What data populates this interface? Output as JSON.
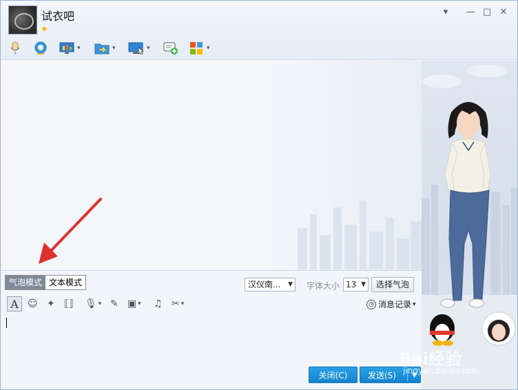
{
  "header": {
    "contact_name": "试衣吧",
    "window_controls": [
      "▾",
      "—",
      "□",
      "✕"
    ]
  },
  "toolbar": {
    "items": [
      {
        "name": "microphone-icon",
        "glyph": "🎙",
        "dropdown": false
      },
      {
        "name": "webcam-icon",
        "glyph": "◉",
        "dropdown": false
      },
      {
        "name": "screen-share-icon",
        "glyph": "▥",
        "dropdown": true
      },
      {
        "name": "file-transfer-icon",
        "glyph": "➜",
        "dropdown": true
      },
      {
        "name": "remote-desktop-icon",
        "glyph": "▭",
        "dropdown": true
      },
      {
        "name": "new-discussion-icon",
        "glyph": "✚",
        "dropdown": false
      },
      {
        "name": "apps-icon",
        "glyph": "▦",
        "dropdown": true
      }
    ]
  },
  "input": {
    "mode_bubble": "气泡模式",
    "mode_text": "文本模式",
    "font_name": "汉仪南...",
    "font_size_label": "字体大小",
    "font_size": "13",
    "choose_bubble": "选择气泡",
    "history": "消息记录",
    "close_button": "关闭(C)",
    "send_button": "发送(S)"
  },
  "watermark": {
    "text": "Bai经验",
    "sub": "jingyan.baidu.com"
  },
  "colors": {
    "accent": "#1a8ad8",
    "arrow": "#e03131"
  }
}
